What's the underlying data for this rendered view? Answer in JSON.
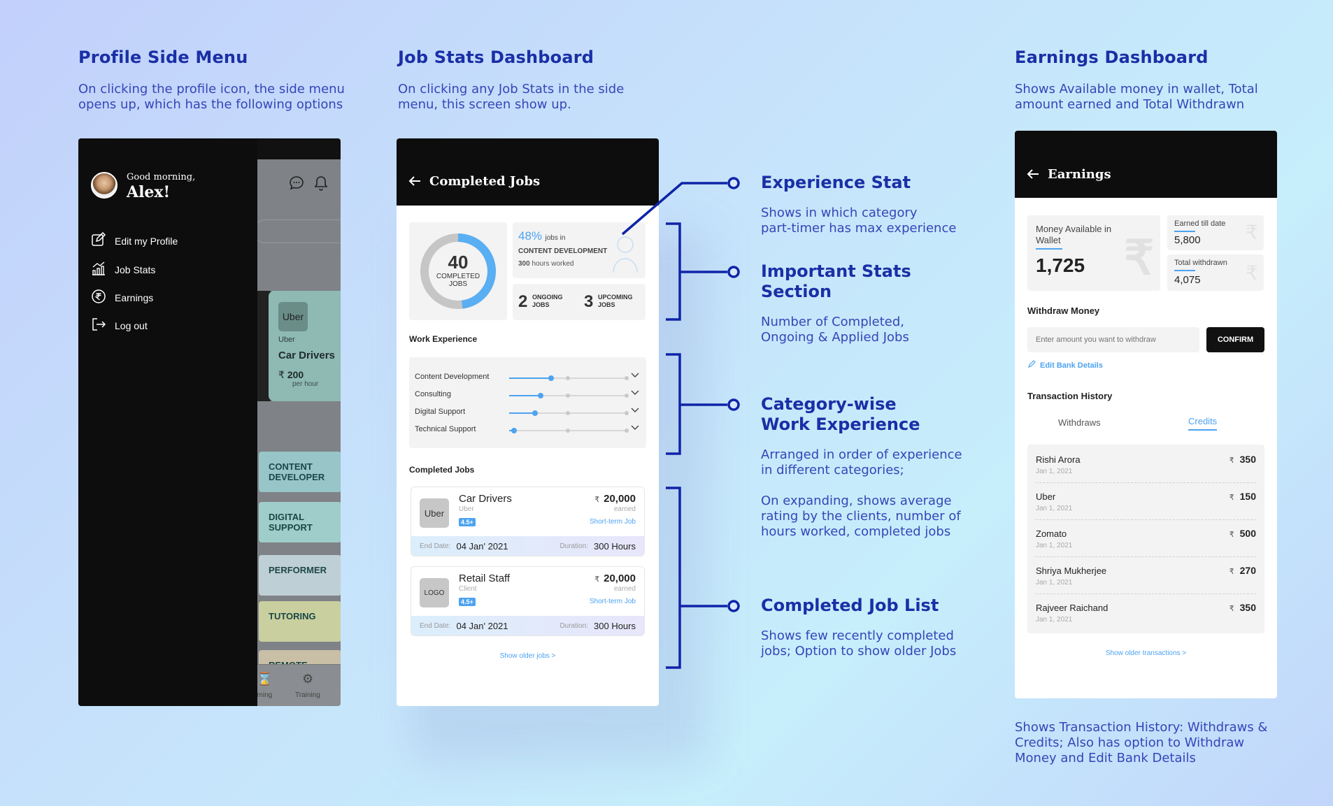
{
  "sections": {
    "profile": {
      "title": "Profile Side Menu",
      "desc_line1": "On clicking the profile icon, the side menu",
      "desc_line2": "opens up, which has the following options"
    },
    "jobstats": {
      "title": "Job Stats Dashboard",
      "desc_line1": "On clicking any Job Stats in the side",
      "desc_line2": "menu, this screen show up."
    },
    "earnings": {
      "title": "Earnings Dashboard",
      "desc_line1": "Shows Available money in wallet, Total",
      "desc_line2": "amount earned and Total Withdrawn",
      "footer_line1": "Shows Transaction History: Withdraws &",
      "footer_line2": "Credits; Also has option to Withdraw",
      "footer_line3": "Money and Edit Bank Details"
    }
  },
  "annotations": {
    "experience": {
      "title": "Experience Stat",
      "desc_line1": "Shows in which category",
      "desc_line2": "part-timer has max experience"
    },
    "important": {
      "title_line1": "Important Stats",
      "title_line2": "Section",
      "desc_line1": "Number of Completed,",
      "desc_line2": "Ongoing & Applied Jobs"
    },
    "category": {
      "title_line1": "Category-wise",
      "title_line2": "Work Experience",
      "desc_line1": "Arranged in order of experience",
      "desc_line2": "in different categories;",
      "desc2_line1": "On expanding, shows average",
      "desc2_line2": "rating by the clients, number of",
      "desc2_line3": "hours worked, completed jobs"
    },
    "completed": {
      "title": "Completed Job List",
      "desc_line1": "Shows few recently completed",
      "desc_line2": "jobs; Option to show older Jobs"
    }
  },
  "side_menu": {
    "greeting": "Good morning,",
    "name": "Alex!",
    "items": [
      {
        "label": "Edit my Profile",
        "icon": "edit-icon"
      },
      {
        "label": "Job Stats",
        "icon": "stats-icon"
      },
      {
        "label": "Earnings",
        "icon": "rupee-icon"
      },
      {
        "label": "Log out",
        "icon": "logout-icon"
      }
    ],
    "bg_card": {
      "logo": "Uber",
      "company": "Uber",
      "title": "Car Drivers",
      "currency": "₹",
      "amount": "200",
      "unit": "per hour"
    },
    "bg_categories": [
      {
        "line1": "CONTENT",
        "line2": "DEVELOPER",
        "color": "#97c5c8"
      },
      {
        "line1": "DIGITAL",
        "line2": "SUPPORT",
        "color": "#9fcdca"
      },
      {
        "line1": "PERFORMER",
        "line2": "",
        "color": "#bfcfd6"
      },
      {
        "line1": "TUTORING",
        "line2": "",
        "color": "#c9cf9e"
      },
      {
        "line1": "REMOTE",
        "line2": "",
        "color": "#c8bfa6"
      }
    ],
    "bg_nav": {
      "label1": "oming",
      "label2": "Training"
    }
  },
  "job_stats": {
    "header": "Completed Jobs",
    "completed_count": "40",
    "completed_label1": "COMPLETED",
    "completed_label2": "JOBS",
    "completed_fraction": 0.48,
    "exp_percent": "48%",
    "exp_jobs_in": "jobs in",
    "exp_category": "CONTENT DEVELOPMENT",
    "exp_hours_num": "300",
    "exp_hours_label": "hours worked",
    "ongoing_count": "2",
    "ongoing_l1": "ONGOING",
    "ongoing_l2": "JOBS",
    "upcoming_count": "3",
    "upcoming_l1": "UPCOMING",
    "upcoming_l2": "JOBS",
    "work_exp_title": "Work Experience",
    "work_exp": [
      {
        "label": "Content Development",
        "level": 0.36
      },
      {
        "label": "Consulting",
        "level": 0.27
      },
      {
        "label": "Digital Support",
        "level": 0.22
      },
      {
        "label": "Technical Support",
        "level": 0.04
      }
    ],
    "completed_title": "Completed Jobs",
    "jobs": [
      {
        "logo": "Uber",
        "title": "Car Drivers",
        "company": "Uber",
        "badge": "4.5+",
        "currency": "₹",
        "amount": "20,000",
        "earned": "earned",
        "type": "Short-term Job",
        "end_label": "End Date:",
        "end_date": "04 Jan' 2021",
        "dur_label": "Duration:",
        "duration": "300 Hours"
      },
      {
        "logo": "LOGO",
        "title": "Retail Staff",
        "company": "Client",
        "badge": "4.5+",
        "currency": "₹",
        "amount": "20,000",
        "earned": "earned",
        "type": "Short-term Job",
        "end_label": "End Date:",
        "end_date": "04 Jan' 2021",
        "dur_label": "Duration:",
        "duration": "300 Hours"
      }
    ],
    "show_older": "Show older jobs >"
  },
  "earnings": {
    "header": "Earnings",
    "wallet_label1": "Money Available in",
    "wallet_label2": "Wallet",
    "wallet_amount": "1,725",
    "earned_label": "Earned till date",
    "earned_amount": "5,800",
    "withdrawn_label": "Total withdrawn",
    "withdrawn_amount": "4,075",
    "withdraw_title": "Withdraw Money",
    "withdraw_placeholder": "Enter amount you want to withdraw",
    "confirm": "CONFIRM",
    "edit_bank": "Edit Bank Details",
    "tx_title": "Transaction History",
    "tab_withdraws": "Withdraws",
    "tab_credits": "Credits",
    "transactions": [
      {
        "name": "Rishi Arora",
        "date": "Jan 1, 2021",
        "currency": "₹",
        "amount": "350"
      },
      {
        "name": "Uber",
        "date": "Jan 1, 2021",
        "currency": "₹",
        "amount": "150"
      },
      {
        "name": "Zomato",
        "date": "Jan 1, 2021",
        "currency": "₹",
        "amount": "500"
      },
      {
        "name": "Shriya Mukherjee",
        "date": "Jan 1, 2021",
        "currency": "₹",
        "amount": "270"
      },
      {
        "name": "Rajveer Raichand",
        "date": "Jan 1, 2021",
        "currency": "₹",
        "amount": "350"
      }
    ],
    "show_older": "Show older transactions >"
  },
  "colors": {
    "accent_blue": "#4da3f0",
    "annotation_blue": "#1a2fa6",
    "dark": "#0d0d0d"
  }
}
